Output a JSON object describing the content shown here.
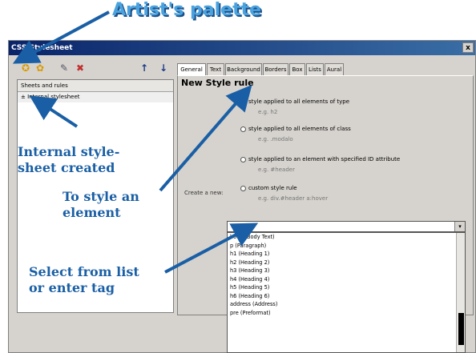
{
  "window": {
    "title": "CSS Stylesheet",
    "close_label": "x"
  },
  "toolbar": {
    "buttons": [
      {
        "name": "new-stylesheet-icon",
        "glyph": "✪"
      },
      {
        "name": "palette-icon",
        "glyph": "✿"
      },
      {
        "name": "edit-icon",
        "glyph": "✎"
      },
      {
        "name": "delete-icon",
        "glyph": "✖"
      },
      {
        "name": "move-up-icon",
        "glyph": "↑"
      },
      {
        "name": "move-down-icon",
        "glyph": "↓"
      }
    ]
  },
  "left_pane": {
    "header": "Sheets and rules",
    "items": [
      "Internal stylesheet"
    ]
  },
  "tabs": [
    "General",
    "Text",
    "Background",
    "Borders",
    "Box",
    "Lists",
    "Aural"
  ],
  "panel": {
    "title": "New Style rule",
    "create_label": "Create a new:",
    "options": [
      {
        "label": "style applied to all elements of type",
        "example": "e.g. h2",
        "checked": true
      },
      {
        "label": "style applied to all elements of class",
        "example": "e.g. .modalo",
        "checked": false
      },
      {
        "label": "style applied to an element with specified ID attribute",
        "example": "e.g. #header",
        "checked": false
      },
      {
        "label": "custom style rule",
        "example": "e.g. div.#header a:hover",
        "checked": false
      }
    ]
  },
  "combo": {
    "value": "",
    "arrow": "▾"
  },
  "dropdown_items": [
    "body (Body Text)",
    "p (Paragraph)",
    "h1 (Heading 1)",
    "h2 (Heading 2)",
    "h3 (Heading 3)",
    "h4 (Heading 4)",
    "h5 (Heading 5)",
    "h6 (Heading 6)",
    "address (Address)",
    "pre (Preformat)"
  ],
  "annotations": {
    "title": "Artist's palette",
    "internal": [
      "Internal style-",
      "sheet created"
    ],
    "style_element": [
      "To style an",
      "element"
    ],
    "select_list": [
      "Select from list",
      "or enter tag"
    ]
  },
  "colors": {
    "annotation": "#1a5fa5",
    "title_annotation": "#4aa3df",
    "titlebar": "#0a246a"
  }
}
